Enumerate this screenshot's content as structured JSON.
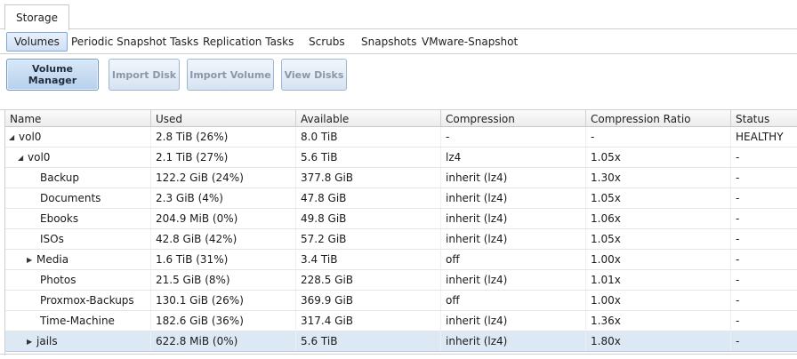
{
  "main_tab": {
    "label": "Storage"
  },
  "sub_tabs": [
    {
      "label": "Volumes",
      "active": true
    },
    {
      "label": "Periodic Snapshot Tasks",
      "active": false
    },
    {
      "label": "Replication Tasks",
      "active": false
    },
    {
      "label": "Scrubs",
      "active": false
    },
    {
      "label": "Snapshots",
      "active": false
    },
    {
      "label": "VMware-Snapshot",
      "active": false
    }
  ],
  "toolbar": {
    "volume_manager": "Volume Manager",
    "import_disk": "Import Disk",
    "import_volume": "Import Volume",
    "view_disks": "View Disks"
  },
  "table": {
    "columns": [
      "Name",
      "Used",
      "Available",
      "Compression",
      "Compression Ratio",
      "Status"
    ],
    "rows": [
      {
        "name": "vol0",
        "level": 0,
        "toggle": "expanded",
        "used": "2.8 TiB (26%)",
        "available": "8.0 TiB",
        "compression": "-",
        "ratio": "-",
        "status": "HEALTHY",
        "selected": false
      },
      {
        "name": "vol0",
        "level": 1,
        "toggle": "expanded",
        "used": "2.1 TiB (27%)",
        "available": "5.6 TiB",
        "compression": "lz4",
        "ratio": "1.05x",
        "status": "-",
        "selected": false
      },
      {
        "name": "Backup",
        "level": 2,
        "toggle": "none",
        "used": "122.2 GiB (24%)",
        "available": "377.8 GiB",
        "compression": "inherit (lz4)",
        "ratio": "1.30x",
        "status": "-",
        "selected": false
      },
      {
        "name": "Documents",
        "level": 2,
        "toggle": "none",
        "used": "2.3 GiB (4%)",
        "available": "47.8 GiB",
        "compression": "inherit (lz4)",
        "ratio": "1.05x",
        "status": "-",
        "selected": false
      },
      {
        "name": "Ebooks",
        "level": 2,
        "toggle": "none",
        "used": "204.9 MiB (0%)",
        "available": "49.8 GiB",
        "compression": "inherit (lz4)",
        "ratio": "1.06x",
        "status": "-",
        "selected": false
      },
      {
        "name": "ISOs",
        "level": 2,
        "toggle": "none",
        "used": "42.8 GiB (42%)",
        "available": "57.2 GiB",
        "compression": "inherit (lz4)",
        "ratio": "1.05x",
        "status": "-",
        "selected": false
      },
      {
        "name": "Media",
        "level": 2,
        "toggle": "collapsed",
        "used": "1.6 TiB (31%)",
        "available": "3.4 TiB",
        "compression": "off",
        "ratio": "1.00x",
        "status": "-",
        "selected": false
      },
      {
        "name": "Photos",
        "level": 2,
        "toggle": "none",
        "used": "21.5 GiB (8%)",
        "available": "228.5 GiB",
        "compression": "inherit (lz4)",
        "ratio": "1.01x",
        "status": "-",
        "selected": false
      },
      {
        "name": "Proxmox-Backups",
        "level": 2,
        "toggle": "none",
        "used": "130.1 GiB (26%)",
        "available": "369.9 GiB",
        "compression": "off",
        "ratio": "1.00x",
        "status": "-",
        "selected": false
      },
      {
        "name": "Time-Machine",
        "level": 2,
        "toggle": "none",
        "used": "182.6 GiB (36%)",
        "available": "317.4 GiB",
        "compression": "inherit (lz4)",
        "ratio": "1.36x",
        "status": "-",
        "selected": false
      },
      {
        "name": "jails",
        "level": 2,
        "toggle": "collapsed",
        "used": "622.8 MiB (0%)",
        "available": "5.6 TiB",
        "compression": "inherit (lz4)",
        "ratio": "1.80x",
        "status": "-",
        "selected": true
      }
    ]
  }
}
